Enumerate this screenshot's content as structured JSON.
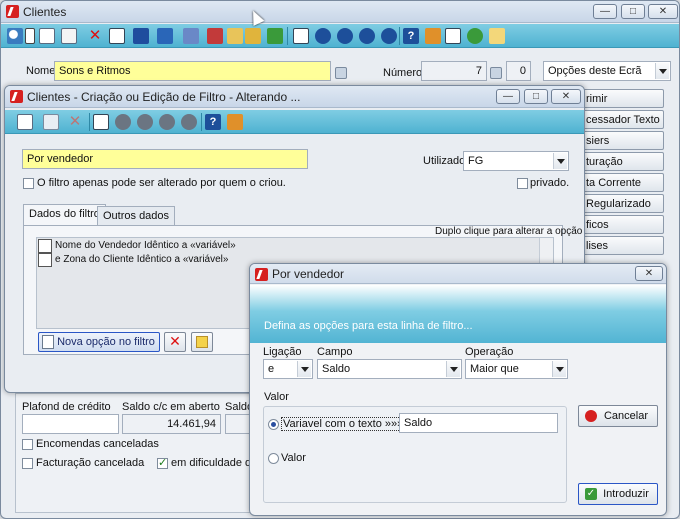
{
  "main": {
    "title": "Clientes",
    "nome_label": "Nome",
    "nome_value": "Sons e Ritmos",
    "numero_label": "Número",
    "numero_value": "7",
    "numero_sub": "0",
    "opcoes_combo": "Opções deste Ecrã",
    "side_buttons": [
      "rimir",
      "cessador Texto",
      "siers",
      "turação",
      "ta Corrente",
      "Regularizado",
      "ficos",
      "lises"
    ],
    "plafond_label": "Plafond de crédito",
    "saldo_cc_label": "Saldo c/c em aberto",
    "saldo_cc_value": "14.461,94",
    "saldo_label": "Saldo",
    "encomendas_label": "Encomendas canceladas",
    "facturacao_label": "Facturação cancelada",
    "dificuldade_label": "em dificuldade de c"
  },
  "filter": {
    "title": "Clientes - Criação ou Edição de Filtro - Alterando ...",
    "name_value": "Por vendedor",
    "utilizador_label": "Utilizador",
    "utilizador_value": "FG",
    "only_creator_label": "O filtro apenas pode ser alterado por quem o criou.",
    "privado_label": "privado.",
    "tab_dados": "Dados do filtro",
    "tab_outros": "Outros dados",
    "hint": "Duplo clique para alterar a opção",
    "rows": [
      "Nome do Vendedor Idêntico a  «variável»",
      "e  Zona do Cliente Idêntico a  «variável»"
    ],
    "nova_opcao": "Nova opção no filtro"
  },
  "dialog": {
    "title": "Por vendedor",
    "banner": "Defina as opções para esta linha de filtro...",
    "ligacao_label": "Ligação",
    "ligacao_value": "e",
    "campo_label": "Campo",
    "campo_value": "Saldo",
    "operacao_label": "Operação",
    "operacao_value": "Maior que",
    "valor_label": "Valor",
    "radio_variavel": "Variavel com o texto »»»",
    "variavel_text": "Saldo",
    "radio_valor": "Valor",
    "cancelar": "Cancelar",
    "introduzir": "Introduzir"
  }
}
